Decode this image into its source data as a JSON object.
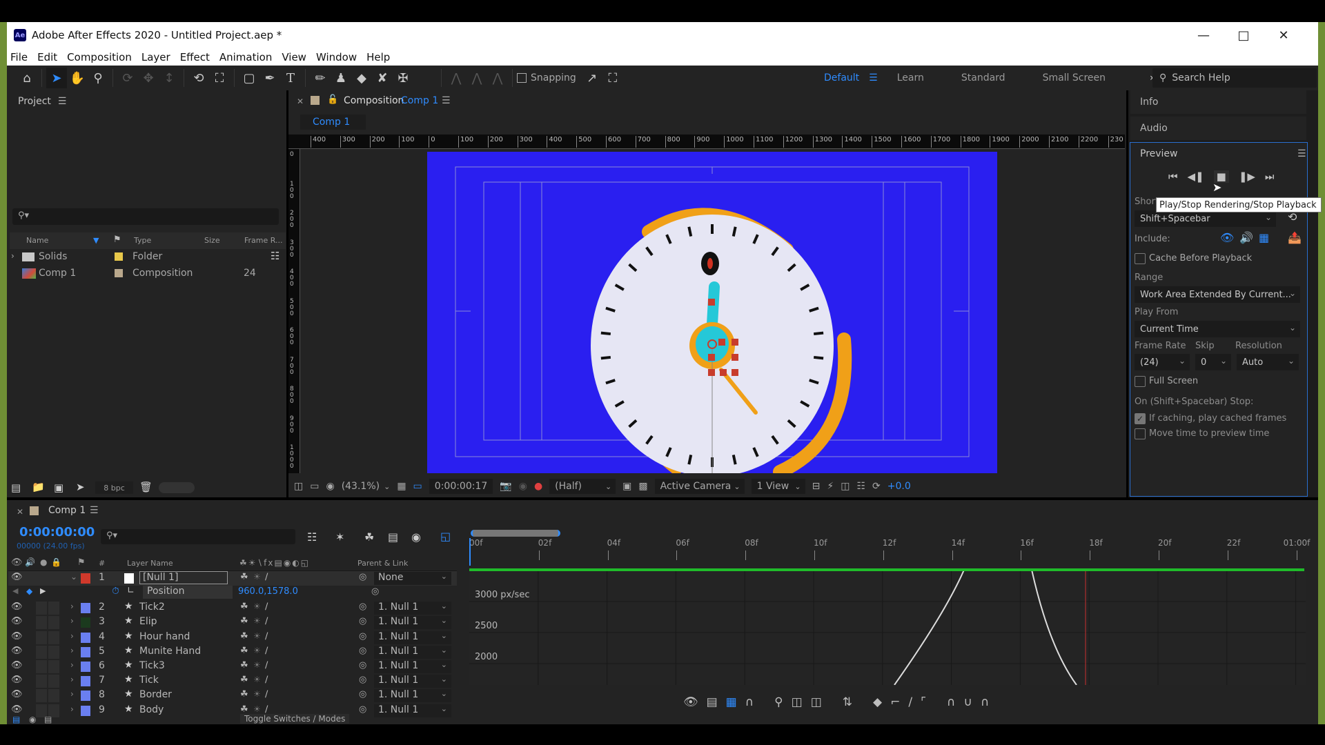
{
  "window": {
    "title": "Adobe After Effects 2020 - Untitled Project.aep *",
    "logo": "Ae",
    "controls": [
      "minimize-icon",
      "maximize-icon",
      "close-icon"
    ]
  },
  "menu": [
    "File",
    "Edit",
    "Composition",
    "Layer",
    "Effect",
    "Animation",
    "View",
    "Window",
    "Help"
  ],
  "toolbar": {
    "tools": [
      "home-icon",
      "selection-tool-icon",
      "hand-tool-icon",
      "zoom-tool-icon",
      "orbit-camera-icon",
      "pan-camera-icon",
      "dolly-camera-icon",
      "rotation-tool-icon",
      "pan-behind-icon",
      "rectangle-tool-icon",
      "pen-tool-icon",
      "type-tool-icon",
      "brush-tool-icon",
      "clone-stamp-icon",
      "eraser-tool-icon",
      "roto-brush-icon",
      "puppet-pin-icon"
    ],
    "snapping_label": "Snapping",
    "workspaces": [
      "Default",
      "Learn",
      "Standard",
      "Small Screen"
    ],
    "active_workspace": "Default",
    "search_placeholder": "Search Help"
  },
  "project": {
    "title": "Project",
    "columns": [
      "Name",
      "Type",
      "Size",
      "Frame R..."
    ],
    "items": [
      {
        "name": "Solids",
        "type": "Folder",
        "size": "",
        "frame_rate": "",
        "label_color": "#e8c84a"
      },
      {
        "name": "Comp 1",
        "type": "Composition",
        "size": "",
        "frame_rate": "24",
        "label_color": "#b9a88c"
      }
    ],
    "bpc": "8 bpc"
  },
  "composition": {
    "tab_prefix": "Composition",
    "tab_name": "Comp 1",
    "subtab": "Comp 1",
    "h_ruler": [
      "400",
      "300",
      "200",
      "100",
      "0",
      "100",
      "200",
      "300",
      "400",
      "500",
      "600",
      "700",
      "800",
      "900",
      "1000",
      "1100",
      "1200",
      "1300",
      "1400",
      "1500",
      "1600",
      "1700",
      "1800",
      "1900",
      "2000",
      "2100",
      "2200",
      "230"
    ],
    "v_ruler": [
      "0",
      "100",
      "200",
      "300",
      "400",
      "500",
      "600",
      "700",
      "800",
      "900",
      "1000"
    ],
    "bg_color": "#2a1ff0",
    "footer": {
      "zoom": "(43.1%)",
      "timecode": "0:00:00:17",
      "resolution": "(Half)",
      "camera": "Active Camera",
      "views": "1 View",
      "exposure": "+0.0"
    }
  },
  "right_panels": {
    "info": "Info",
    "audio": "Audio",
    "preview": {
      "title": "Preview",
      "tooltip": "Play/Stop Rendering/Stop Playback",
      "shortcut_label": "Shortcut",
      "shortcut": "Shift+Spacebar",
      "include_label": "Include:",
      "cache_before_playback": {
        "label": "Cache Before Playback",
        "checked": false
      },
      "range_label": "Range",
      "range": "Work Area Extended By Current...",
      "play_from_label": "Play From",
      "play_from": "Current Time",
      "frame_rate_label": "Frame Rate",
      "frame_rate": "(24)",
      "skip_label": "Skip",
      "skip": "0",
      "resolution_label": "Resolution",
      "resolution": "Auto",
      "full_screen": {
        "label": "Full Screen",
        "checked": false
      },
      "on_stop_label": "On (Shift+Spacebar) Stop:",
      "play_cached": {
        "label": "If caching, play cached frames",
        "checked": true
      },
      "move_time": {
        "label": "Move time to preview time",
        "checked": false
      }
    }
  },
  "timeline": {
    "tab": "Comp 1",
    "timecode": "0:00:00:00",
    "frame_info": "00000 (24.00 fps)",
    "columns": {
      "number": "#",
      "layer_name": "Layer Name",
      "parent": "Parent & Link"
    },
    "layers": [
      {
        "num": "1",
        "name": "[Null 1]",
        "parent": "None",
        "label_color": "#d0392b",
        "selected": true
      },
      {
        "num": "2",
        "name": "Tick2",
        "parent": "1. Null 1",
        "label_color": "#6a7ff0"
      },
      {
        "num": "3",
        "name": "Elip",
        "parent": "1. Null 1",
        "label_color": "#1b3a1e"
      },
      {
        "num": "4",
        "name": "Hour hand",
        "parent": "1. Null 1",
        "label_color": "#6a7ff0"
      },
      {
        "num": "5",
        "name": "Munite Hand",
        "parent": "1. Null 1",
        "label_color": "#6a7ff0"
      },
      {
        "num": "6",
        "name": "Tick3",
        "parent": "1. Null 1",
        "label_color": "#6a7ff0"
      },
      {
        "num": "7",
        "name": "Tick",
        "parent": "1. Null 1",
        "label_color": "#6a7ff0"
      },
      {
        "num": "8",
        "name": "Border",
        "parent": "1. Null 1",
        "label_color": "#6a7ff0"
      },
      {
        "num": "9",
        "name": "Body",
        "parent": "1. Null 1",
        "label_color": "#6a7ff0"
      }
    ],
    "property": {
      "name": "Position",
      "value": "960.0,1578.0"
    },
    "ruler_labels": [
      "00f",
      "02f",
      "04f",
      "06f",
      "08f",
      "10f",
      "12f",
      "14f",
      "16f",
      "18f",
      "20f",
      "22f",
      "01:00f"
    ],
    "graph_labels": [
      "3000 px/sec",
      "2500",
      "2000"
    ],
    "toggle_label": "Toggle Switches / Modes"
  }
}
